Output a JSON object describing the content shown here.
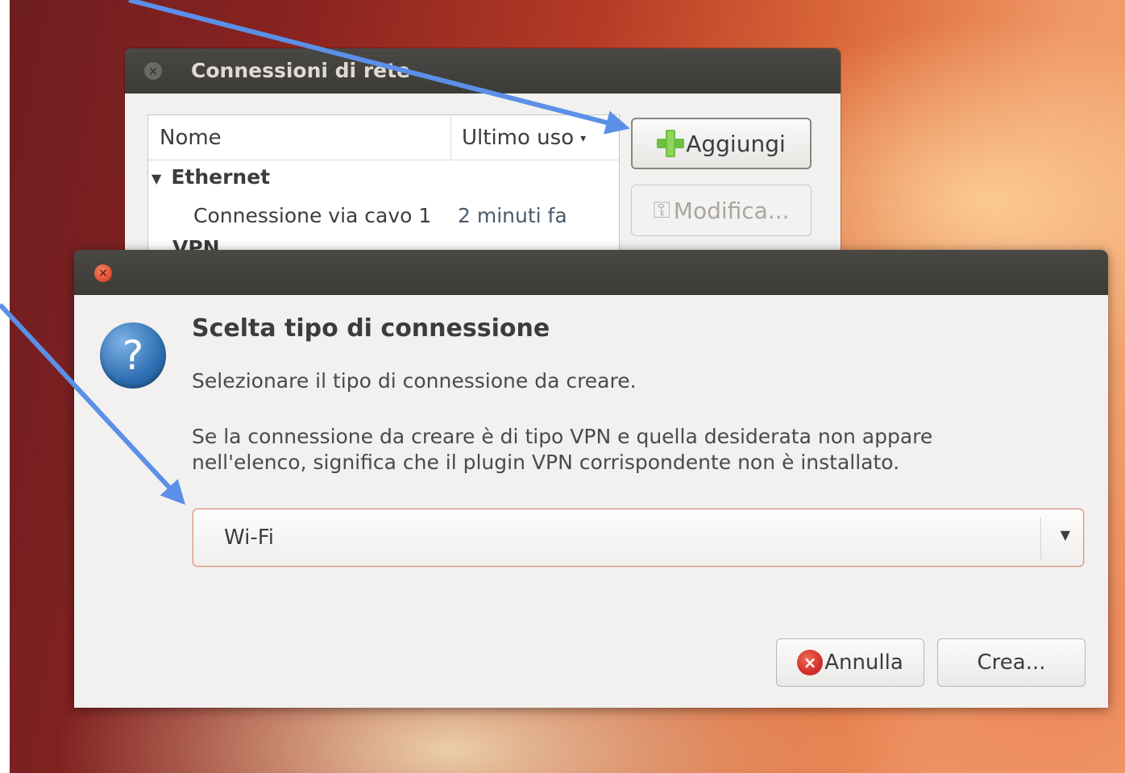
{
  "background_window": {
    "title": "Connessioni di rete",
    "columns": [
      "Nome",
      "Ultimo uso"
    ],
    "sort_indicator": "▾",
    "groups": [
      {
        "name": "Ethernet",
        "expander": "▼",
        "connections": [
          {
            "name": "Connessione via cavo 1",
            "last_used": "2 minuti fa"
          }
        ]
      },
      {
        "name": "VPN"
      }
    ],
    "add_label": "Aggiungi",
    "edit_label": "Modifica..."
  },
  "dialog": {
    "heading": "Scelta tipo di connessione",
    "message": "Selezionare il tipo di connessione da creare.",
    "detail_line1": "Se la connessione da creare è di tipo VPN e quella desiderata non appare",
    "detail_line2": "nell'elenco, significa che il plugin VPN corrispondente non è installato.",
    "connection_type": "Wi-Fi",
    "cancel_label": "Annulla",
    "create_label": "Crea...",
    "close_glyph": "×",
    "question_glyph": "?"
  },
  "annotations": {
    "arrow_color": "#5b8fe8"
  },
  "icons": [
    "close-icon",
    "add-icon",
    "edit-icon",
    "question-icon",
    "cancel-icon",
    "dropdown-arrow-icon"
  ]
}
